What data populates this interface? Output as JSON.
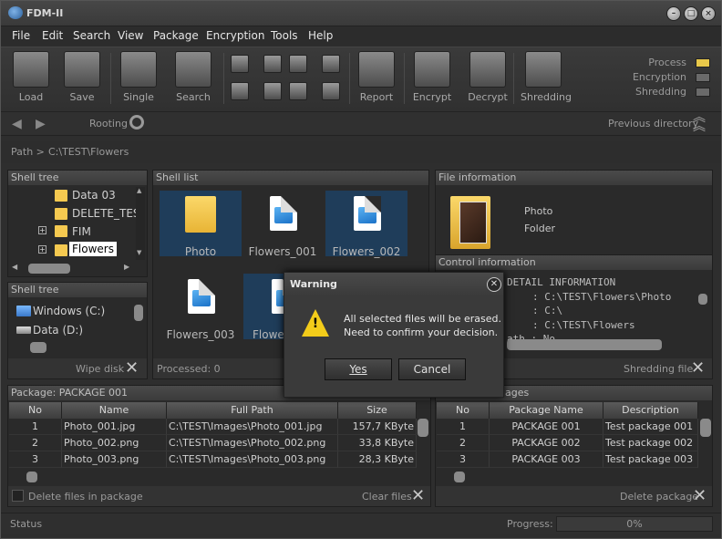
{
  "app": {
    "title": "FDM-II"
  },
  "menu": [
    "File",
    "Edit",
    "Search",
    "View",
    "Package",
    "Encryption",
    "Tools",
    "Help"
  ],
  "toolbar": {
    "load": "Load",
    "save": "Save",
    "single": "Single",
    "search": "Search",
    "report": "Report",
    "encrypt": "Encrypt",
    "decrypt": "Decrypt",
    "shredding": "Shredding"
  },
  "status_indicators": {
    "process": "Process",
    "encryption": "Encryption",
    "shredding": "Shredding",
    "process_color": "#e8c84a",
    "encryption_color": "#6a6a6a",
    "shredding_color": "#6a6a6a"
  },
  "nav": {
    "rooting": "Rooting",
    "previous_directory": "Previous directory"
  },
  "path": {
    "label": "Path >",
    "value": "C:\\TEST\\Flowers"
  },
  "shell_tree": {
    "title": "Shell tree",
    "items": [
      "Data 03",
      "DELETE_TES",
      "FIM",
      "Flowers"
    ]
  },
  "shell_tree2": {
    "title": "Shell tree",
    "items": [
      "Windows (C:)",
      "Data (D:)"
    ],
    "footer": "Wipe disk"
  },
  "shell_list": {
    "title": "Shell list",
    "items": [
      "Photo",
      "Flowers_001",
      "Flowers_002",
      "Flowers_003",
      "Flowe"
    ],
    "processed": "Processed: 0"
  },
  "file_info": {
    "title": "File information",
    "name": "Photo",
    "type": "Folder"
  },
  "control_info": {
    "title": "Control information",
    "lines": [
      "DETAIL INFORMATION",
      ": C:\\TEST\\Flowers\\Photo",
      ": C:\\",
      ": C:\\TEST\\Flowers",
      "ath : No"
    ],
    "footer": "Shredding file"
  },
  "package": {
    "title": "Package: PACKAGE 001",
    "columns": [
      "No",
      "Name",
      "Full Path",
      "Size"
    ],
    "rows": [
      [
        "1",
        "Photo_001.jpg",
        "C:\\TEST\\Images\\Photo_001.jpg",
        "157,7 KByte"
      ],
      [
        "2",
        "Photo_002.png",
        "C:\\TEST\\Images\\Photo_002.png",
        "33,8 KByte"
      ],
      [
        "3",
        "Photo_003.png",
        "C:\\TEST\\Images\\Photo_003.png",
        "28,3 KByte"
      ]
    ],
    "delete_files": "Delete files in package",
    "clear_files": "Clear files"
  },
  "packages": {
    "title": "ages",
    "columns": [
      "No",
      "Package Name",
      "Description"
    ],
    "rows": [
      [
        "1",
        "PACKAGE 001",
        "Test package 001"
      ],
      [
        "2",
        "PACKAGE 002",
        "Test package 002"
      ],
      [
        "3",
        "PACKAGE 003",
        "Test package 003"
      ]
    ],
    "delete_package": "Delete package"
  },
  "statusbar": {
    "status": "Status",
    "progress_label": "Progress:",
    "progress": "0%"
  },
  "dialog": {
    "title": "Warning",
    "line1": "All selected files will be erased.",
    "line2": "Need to confirm your decision.",
    "yes": "Yes",
    "cancel": "Cancel"
  }
}
